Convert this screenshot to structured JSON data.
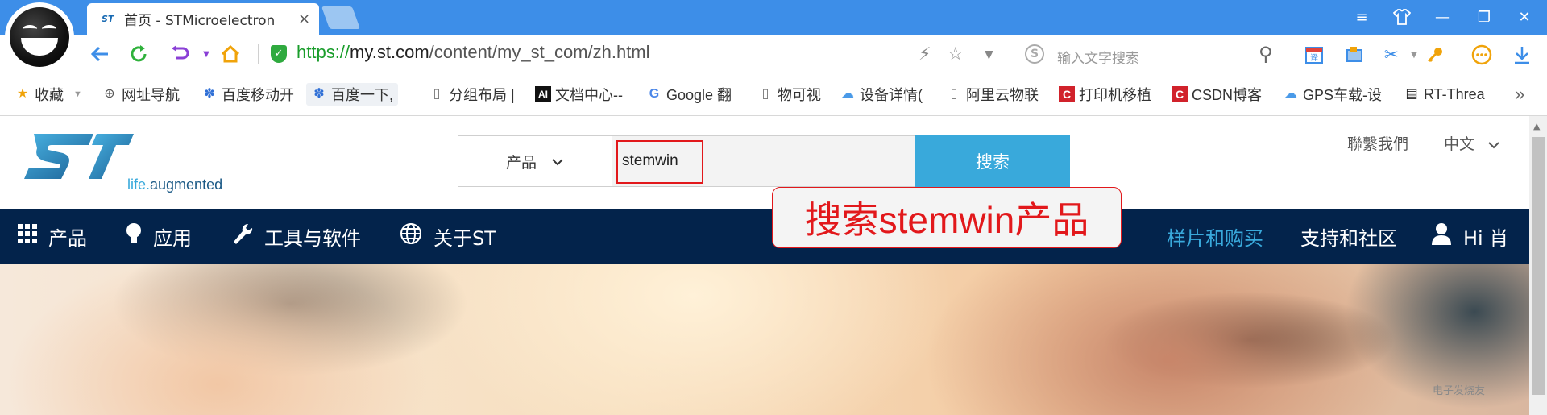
{
  "browser": {
    "tab": {
      "title": "首页 - STMicroelectron",
      "close": "×"
    },
    "window_controls": [
      "≡",
      "👕",
      "—",
      "❐",
      "✕"
    ],
    "address": {
      "protocol": "https://",
      "host": "my.st.com",
      "path": "/content/my_st_com/zh.html"
    },
    "search": {
      "placeholder": "输入文字搜索",
      "engine_icon": "S"
    },
    "bookmarks": [
      {
        "label": "收藏",
        "icon": "star-icon"
      },
      {
        "label": "网址导航",
        "icon": "globe-icon"
      },
      {
        "label": "百度移动开",
        "icon": "baidu-icon"
      },
      {
        "label": "百度一下,",
        "icon": "baidu-icon"
      },
      {
        "label": "分组布局 |",
        "icon": "page-icon"
      },
      {
        "label": "文档中心--",
        "icon": "ai-icon"
      },
      {
        "label": "Google 翻",
        "icon": "google-translate-icon"
      },
      {
        "label": "物可视",
        "icon": "page-icon"
      },
      {
        "label": "设备详情(",
        "icon": "cloud-icon"
      },
      {
        "label": "阿里云物联",
        "icon": "page-icon"
      },
      {
        "label": "打印机移植",
        "icon": "csdn-icon"
      },
      {
        "label": "CSDN博客",
        "icon": "csdn-icon"
      },
      {
        "label": "GPS车载-设",
        "icon": "cloud-icon"
      },
      {
        "label": "RT-Threa",
        "icon": "book-icon"
      }
    ],
    "more_bookmarks": "»"
  },
  "site": {
    "tagline": {
      "life": "life.",
      "augmented": "augmented"
    },
    "search": {
      "category": "产品",
      "query": "stemwin",
      "button": "搜索"
    },
    "utility": {
      "contact": "聯繫我們",
      "language": "中文"
    },
    "nav": {
      "products": "产品",
      "applications": "应用",
      "tools": "工具与软件",
      "about": "关于ST",
      "samples": "样片和购买",
      "support": "支持和社区",
      "user": "Hi 肖"
    },
    "annotation": "搜索stemwin产品",
    "watermark": "电子发烧友"
  },
  "colors": {
    "browser_blue": "#3d8ee8",
    "st_navy": "#03234b",
    "st_blue": "#39a9db",
    "annotation_red": "#e2181b",
    "secure_green": "#1a9d2b"
  }
}
